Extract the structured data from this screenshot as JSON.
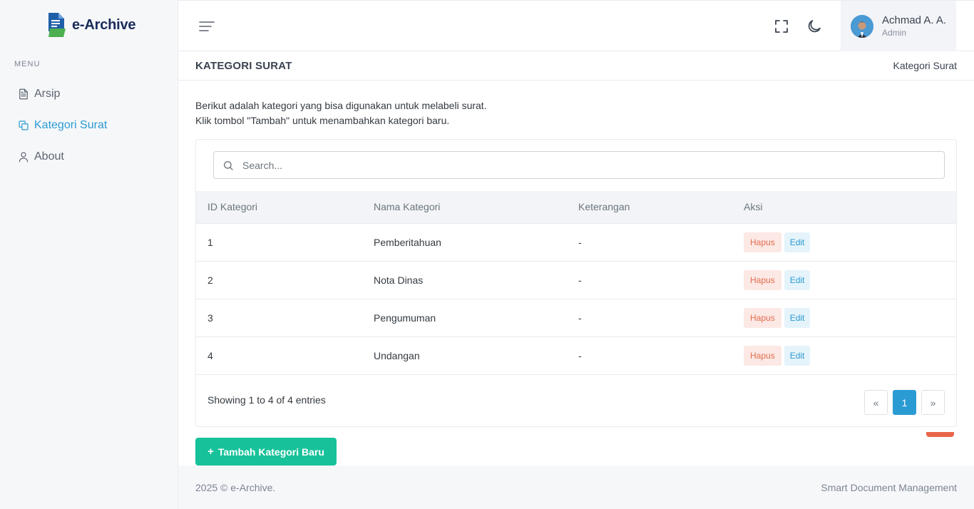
{
  "app": {
    "name": "e-Archive",
    "accent_color": "#2b9bd3",
    "success_color": "#17c29a",
    "danger_color": "#e36d4f"
  },
  "sidebar": {
    "menu_title": "MENU",
    "items": [
      {
        "label": "Arsip",
        "icon": "file-text-icon",
        "active": false
      },
      {
        "label": "Kategori Surat",
        "icon": "copy-icon",
        "active": true
      },
      {
        "label": "About",
        "icon": "user-icon",
        "active": false
      }
    ]
  },
  "topbar": {
    "user_name": "Achmad A. A.",
    "user_role": "Admin"
  },
  "page": {
    "title": "KATEGORI SURAT",
    "breadcrumb": "Kategori Surat",
    "intro_line1": "Berikut adalah kategori yang bisa digunakan untuk melabeli surat.",
    "intro_line2": "Klik tombol \"Tambah\" untuk menambahkan kategori baru."
  },
  "search": {
    "placeholder": "Search...",
    "value": ""
  },
  "table": {
    "headers": [
      "ID Kategori",
      "Nama Kategori",
      "Keterangan",
      "Aksi"
    ],
    "rows": [
      {
        "id": "1",
        "name": "Pemberitahuan",
        "ket": "-"
      },
      {
        "id": "2",
        "name": "Nota Dinas",
        "ket": "-"
      },
      {
        "id": "3",
        "name": "Pengumuman",
        "ket": "-"
      },
      {
        "id": "4",
        "name": "Undangan",
        "ket": "-"
      }
    ],
    "delete_label": "Hapus",
    "edit_label": "Edit"
  },
  "pagination": {
    "info": "Showing 1 to 4 of 4 entries",
    "prev": "«",
    "current": "1",
    "next": "»"
  },
  "actions": {
    "add_label": "Tambah Kategori Baru",
    "add_icon": "+"
  },
  "footer": {
    "left": "2025 © e-Archive.",
    "right": "Smart Document Management"
  }
}
